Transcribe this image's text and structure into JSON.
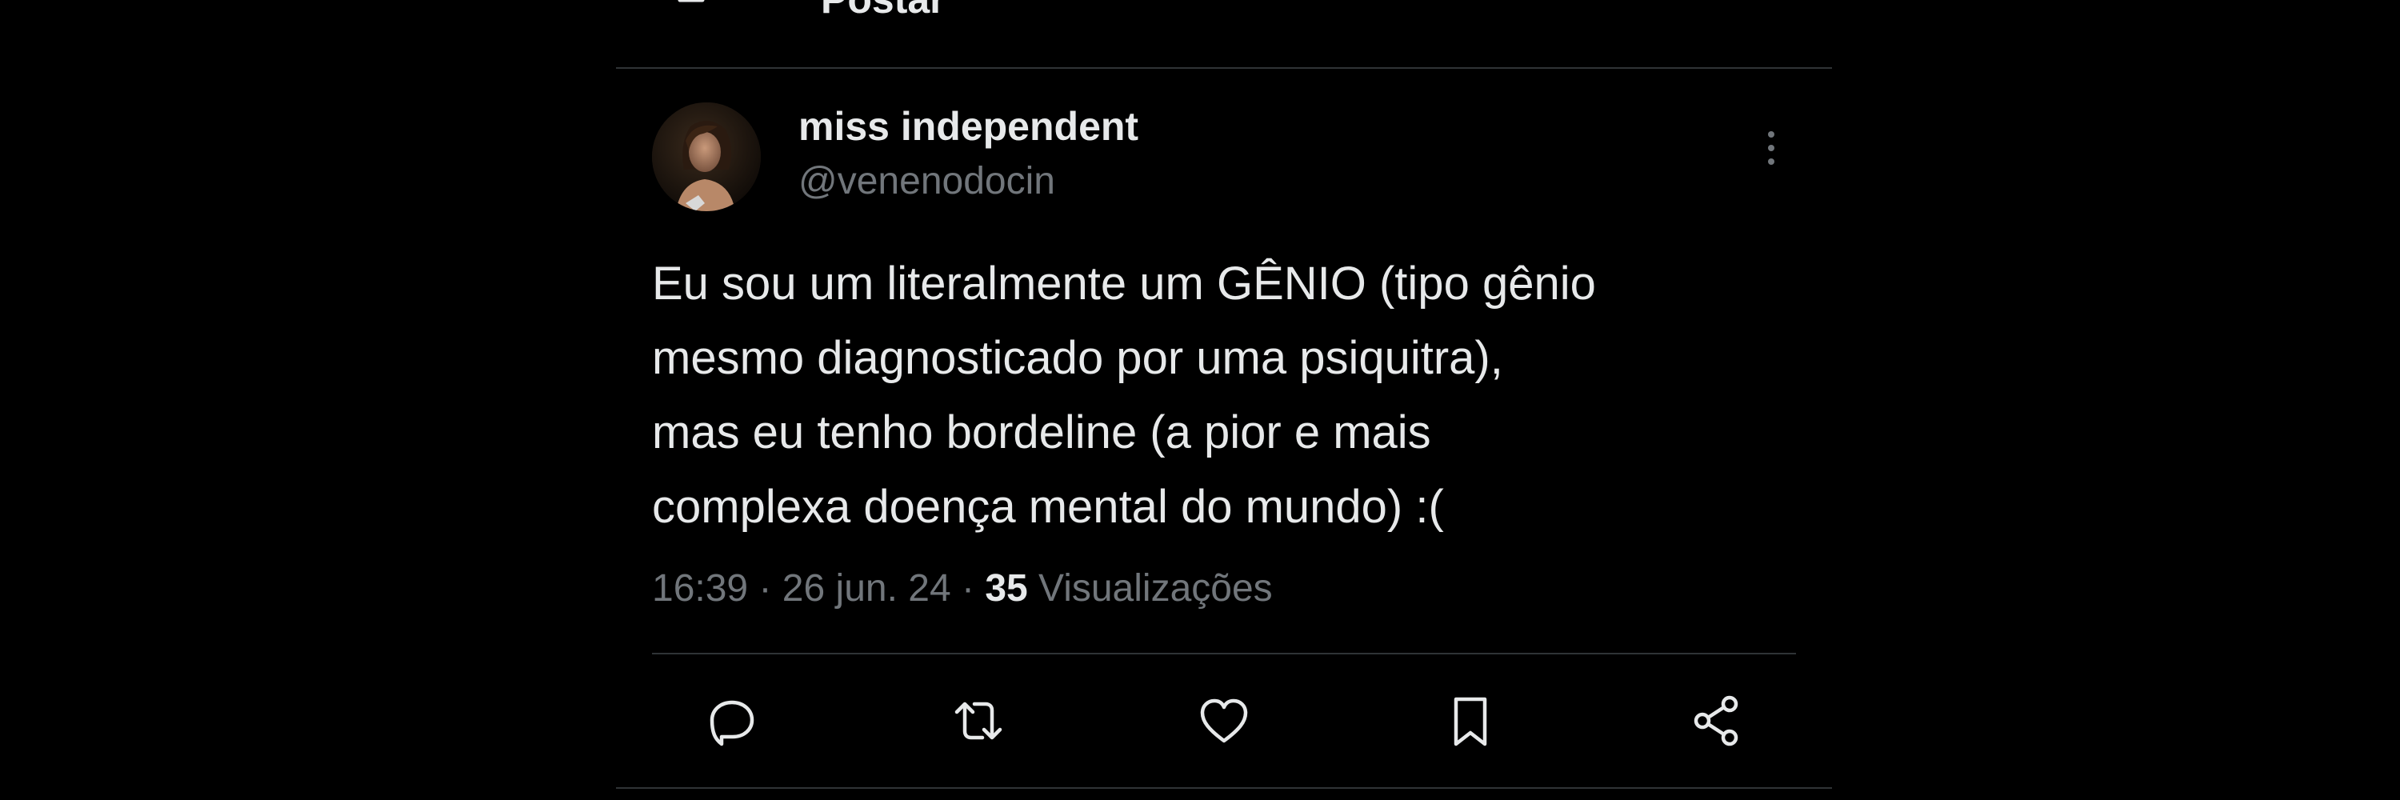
{
  "header": {
    "title": "Postar",
    "back_icon": "arrow-left-icon"
  },
  "post": {
    "author": {
      "display_name": "miss independent",
      "handle": "@venenodocin",
      "avatar_icon": "profile-avatar"
    },
    "text_lines": [
      "Eu sou um literalmente um GÊNIO (tipo gênio",
      "mesmo diagnosticado por uma psiquitra),",
      "mas eu tenho bordeline (a pior e mais",
      "complexa doença mental do mundo) :("
    ],
    "time": "16:39",
    "date": "26 jun. 24",
    "views_count": "35",
    "views_label": "Visualizações",
    "separator": "·"
  },
  "actions": [
    {
      "name": "reply",
      "icon": "comment-icon"
    },
    {
      "name": "repost",
      "icon": "repost-icon"
    },
    {
      "name": "like",
      "icon": "heart-icon"
    },
    {
      "name": "bookmark",
      "icon": "bookmark-icon"
    },
    {
      "name": "share",
      "icon": "share-icon"
    }
  ],
  "colors": {
    "background": "#000000",
    "primary_text": "#e7e9ea",
    "secondary_text": "#71767b",
    "divider": "#2f3336"
  }
}
